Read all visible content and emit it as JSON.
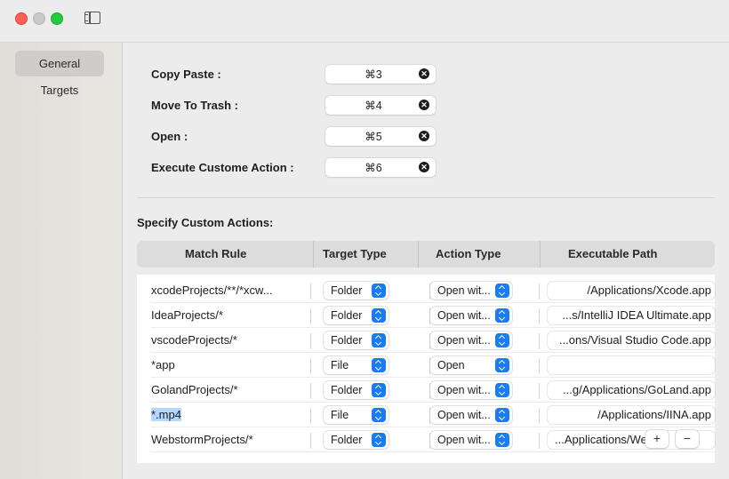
{
  "window": {
    "traffic_lights": [
      "close",
      "minimize",
      "zoom"
    ],
    "toolbar_icon": "sidebar-toggle-icon"
  },
  "sidebar": {
    "items": [
      {
        "label": "General",
        "active": true
      },
      {
        "label": "Targets",
        "active": false
      }
    ]
  },
  "hotkeys": [
    {
      "label": "Copy Paste :",
      "value": "⌘3"
    },
    {
      "label": "Move To Trash :",
      "value": "⌘4"
    },
    {
      "label": "Open :",
      "value": "⌘5"
    },
    {
      "label": "Execute Custome Action :",
      "value": "⌘6"
    }
  ],
  "custom_actions": {
    "title": "Specify Custom Actions:",
    "columns": [
      "Match Rule",
      "Target Type",
      "Action Type",
      "Executable Path"
    ],
    "rows": [
      {
        "match": "xcodeProjects/**/*xcw...",
        "target": "Folder",
        "action": "Open wit...",
        "path": "/Applications/Xcode.app"
      },
      {
        "match": "IdeaProjects/*",
        "target": "Folder",
        "action": "Open wit...",
        "path": "...s/IntelliJ IDEA Ultimate.app"
      },
      {
        "match": "vscodeProjects/*",
        "target": "Folder",
        "action": "Open wit...",
        "path": "...ons/Visual Studio Code.app"
      },
      {
        "match": "*app",
        "target": "File",
        "action": "Open",
        "path": ""
      },
      {
        "match": "GolandProjects/*",
        "target": "Folder",
        "action": "Open wit...",
        "path": "...g/Applications/GoLand.app"
      },
      {
        "match": "*.mp4",
        "target": "File",
        "action": "Open wit...",
        "path": "/Applications/IINA.app",
        "selected_text": true
      },
      {
        "match": "WebstormProjects/*",
        "target": "Folder",
        "action": "Open wit...",
        "path": "...Applications/We"
      }
    ],
    "add_label": "+",
    "remove_label": "−"
  },
  "colors": {
    "accent": "#1a7cf5",
    "close": "#fe5f57",
    "zoom": "#28c840",
    "selection": "#b3d7ff"
  }
}
